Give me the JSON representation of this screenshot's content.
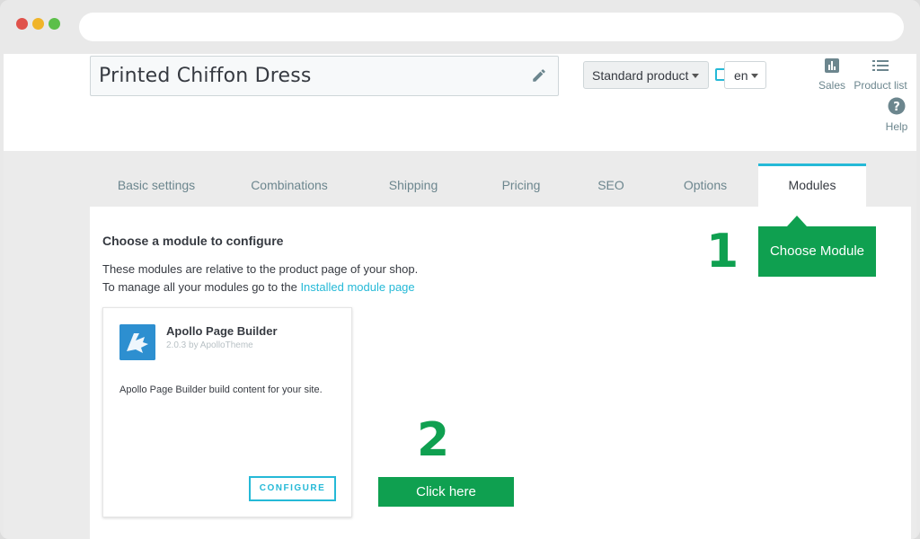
{
  "product": {
    "title": "Printed Chiffon Dress",
    "type_selected": "Standard product",
    "language_selected": "en"
  },
  "toolbar": {
    "sales_label": "Sales",
    "product_list_label": "Product list",
    "help_label": "Help"
  },
  "tabs": [
    {
      "label": "Basic settings"
    },
    {
      "label": "Combinations"
    },
    {
      "label": "Shipping"
    },
    {
      "label": "Pricing"
    },
    {
      "label": "SEO"
    },
    {
      "label": "Options"
    },
    {
      "label": "Modules",
      "active": true
    }
  ],
  "panel": {
    "title": "Choose a module to configure",
    "desc_line1": "These modules are relative to the product page of your shop.",
    "desc_line2_prefix": "To manage all your modules go to the",
    "desc_link": "Installed module page"
  },
  "module_card": {
    "name": "Apollo Page Builder",
    "version": "2.0.3 by ApolloTheme",
    "description": "Apollo Page Builder build content for your site.",
    "button_label": "CONFIGURE"
  },
  "annotations": {
    "step1_number": "1",
    "step1_label": "Choose Module",
    "step2_number": "2",
    "step2_label": "Click here"
  },
  "colors": {
    "accent": "#25b9d7",
    "annotation_green": "#0fa050"
  }
}
